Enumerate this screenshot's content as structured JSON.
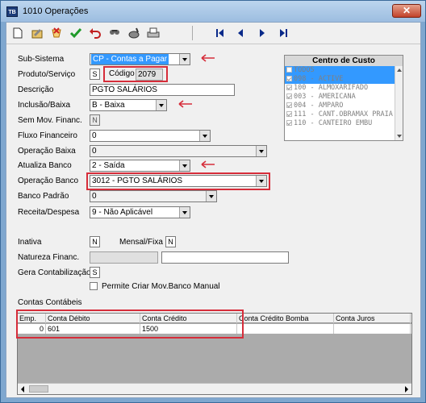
{
  "window": {
    "title": "1010 Operações",
    "icon_text": "TB",
    "close_label": "✕"
  },
  "toolbar": {
    "icons": [
      "new-document-icon",
      "edit-icon",
      "cancel-icon",
      "confirm-icon",
      "undo-icon",
      "search-icon",
      "delete-icon",
      "print-icon"
    ]
  },
  "form": {
    "subsistema_label": "Sub-Sistema",
    "subsistema_value": "CP - Contas a Pagar",
    "produto_label": "Produto/Serviço",
    "produto_value": "S",
    "codigo_label": "Código",
    "codigo_value": "2079",
    "descricao_label": "Descrição",
    "descricao_value": "PGTO SALÁRIOS",
    "inclusao_label": "Inclusão/Baixa",
    "inclusao_value": "B - Baixa",
    "semmov_label": "Sem Mov. Financ.",
    "semmov_value": "N",
    "fluxo_label": "Fluxo Financeiro",
    "fluxo_value": "0",
    "opbaixa_label": "Operação Baixa",
    "opbaixa_value": "0",
    "atualiza_label": "Atualiza Banco",
    "atualiza_value": "2 - Saída",
    "opbanco_label": "Operação Banco",
    "opbanco_value": "3012 - PGTO SALÁRIOS",
    "bancopadrao_label": "Banco Padrão",
    "bancopadrao_value": "0",
    "receita_label": "Receita/Despesa",
    "receita_value": "9 - Não Aplicável",
    "inativa_label": "Inativa",
    "inativa_value": "N",
    "mensal_label": "Mensal/Fixa",
    "mensal_value": "N",
    "natureza_label": "Natureza Financ.",
    "gera_label": "Gera Contabilização",
    "gera_value": "S",
    "permite_label": "Permite Criar Mov.Banco Manual"
  },
  "centro_custo": {
    "title": "Centro de Custo",
    "items": [
      {
        "text": "TODOS",
        "checked": false,
        "selected": true
      },
      {
        "text": "098 - ACTIVE",
        "checked": true,
        "selected": true
      },
      {
        "text": "100 - ALMOXARIFADO",
        "checked": true,
        "selected": false
      },
      {
        "text": "003 - AMERICANA",
        "checked": true,
        "selected": false
      },
      {
        "text": "004 - AMPARO",
        "checked": true,
        "selected": false
      },
      {
        "text": "111 - CANT.OBRAMAX PRAIA",
        "checked": true,
        "selected": false
      },
      {
        "text": "110 - CANTEIRO EMBU",
        "checked": true,
        "selected": false
      }
    ]
  },
  "contas": {
    "section_label": "Contas Contábeis",
    "headers": [
      "Emp.",
      "Conta Débito",
      "Conta Crédito",
      "Conta Crédito Bomba",
      "Conta Juros"
    ],
    "rows": [
      [
        "0",
        "601",
        "1500",
        "",
        ""
      ]
    ]
  },
  "colors": {
    "accent_red": "#d62d3a",
    "selection": "#3399ff"
  }
}
